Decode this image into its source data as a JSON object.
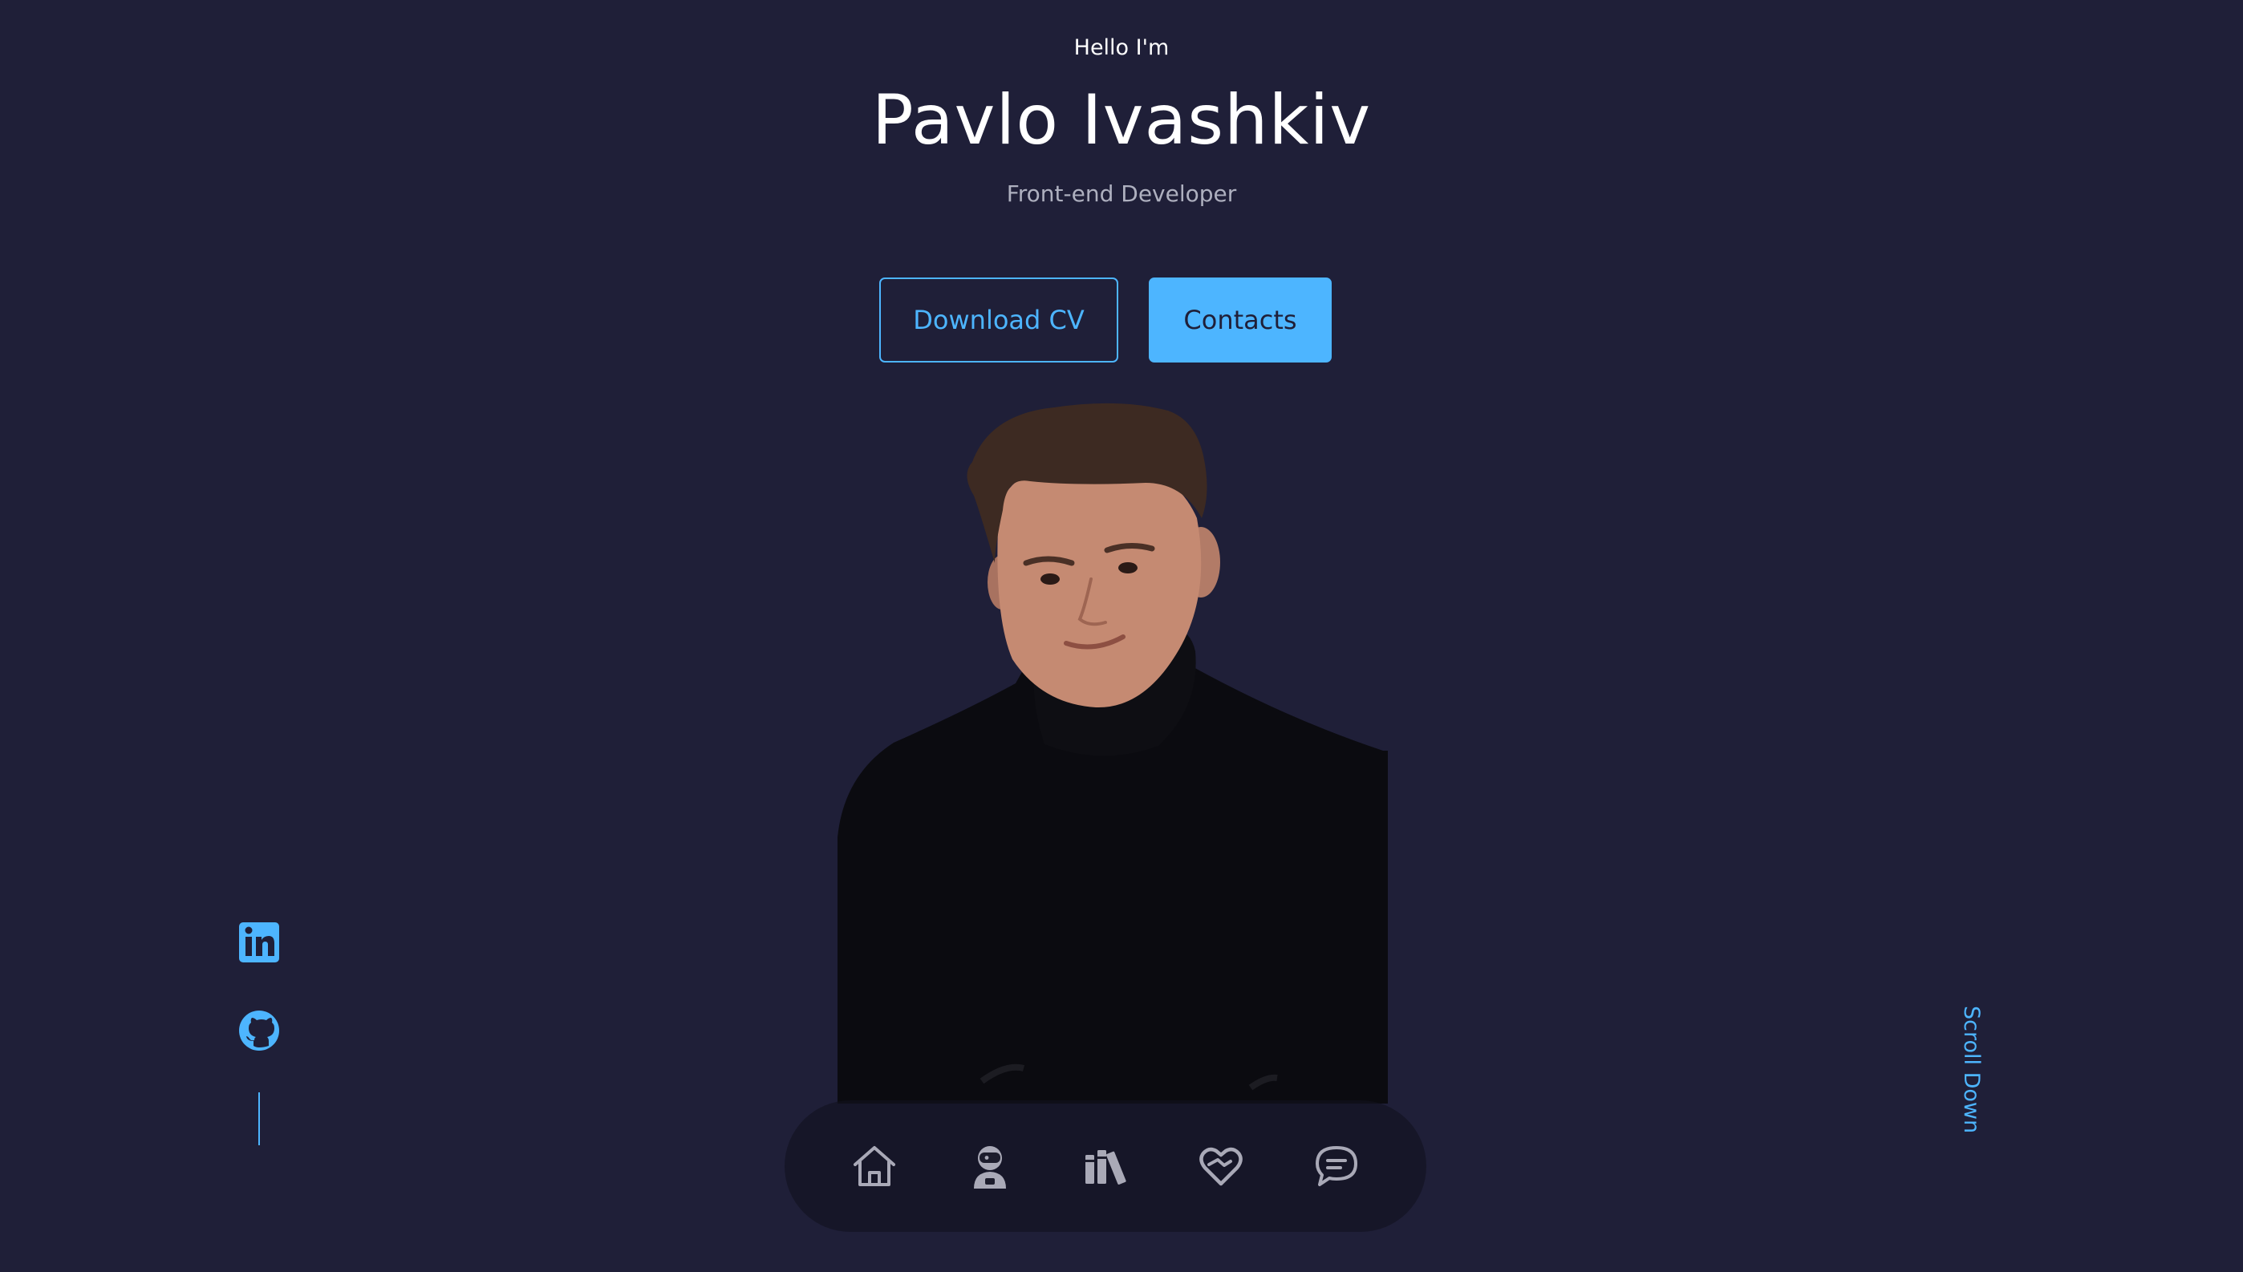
{
  "hero": {
    "greeting": "Hello I'm",
    "name": "Pavlo Ivashkiv",
    "role": "Front-end Developer"
  },
  "cta": {
    "download_label": "Download CV",
    "contacts_label": "Contacts"
  },
  "socials": [
    {
      "icon": "linkedin-icon"
    },
    {
      "icon": "github-icon"
    }
  ],
  "scroll": {
    "label": "Scroll Down"
  },
  "nav": {
    "items": [
      {
        "icon": "home-icon"
      },
      {
        "icon": "about-icon"
      },
      {
        "icon": "books-icon"
      },
      {
        "icon": "services-icon"
      },
      {
        "icon": "chat-icon"
      }
    ]
  },
  "colors": {
    "background": "#1f1f38",
    "accent": "#4db5ff",
    "text_muted": "#aeb0bf"
  }
}
